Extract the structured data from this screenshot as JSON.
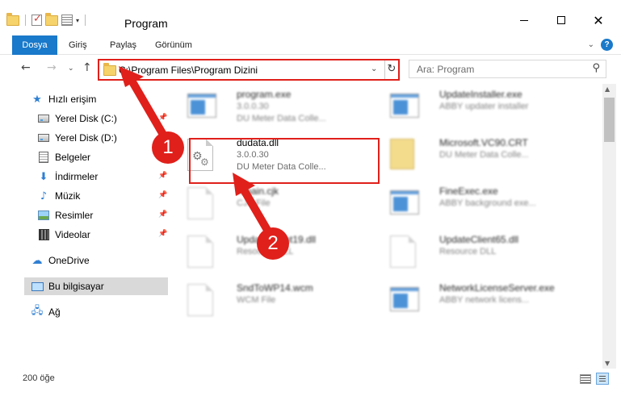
{
  "window": {
    "title": "Program",
    "minimize": "—",
    "maximize": "",
    "close": "✕"
  },
  "ribbon": {
    "tabs": [
      "Dosya",
      "Giriş",
      "Paylaş",
      "Görünüm"
    ],
    "expand_symbol": "⌄",
    "help_symbol": "?"
  },
  "navigation": {
    "back_symbol": "←",
    "forward_symbol": "→",
    "recent_symbol": "⌄",
    "up_symbol": "↑",
    "address": "C:\\Program Files\\Program Dizini",
    "address_dropdown_symbol": "⌄",
    "refresh_symbol": "↻",
    "search_placeholder": "Ara: Program",
    "search_symbol": "⚲"
  },
  "sidebar": {
    "items": [
      {
        "label": "Hızlı erişim",
        "icon": "star-icon",
        "pinned": false
      },
      {
        "label": "Yerel Disk (C:)",
        "icon": "drive-icon",
        "pinned": true
      },
      {
        "label": "Yerel Disk (D:)",
        "icon": "drive-icon",
        "pinned": true
      },
      {
        "label": "Belgeler",
        "icon": "documents-icon",
        "pinned": true
      },
      {
        "label": "İndirmeler",
        "icon": "download-icon",
        "pinned": true
      },
      {
        "label": "Müzik",
        "icon": "music-icon",
        "pinned": true
      },
      {
        "label": "Resimler",
        "icon": "pictures-icon",
        "pinned": true
      },
      {
        "label": "Videolar",
        "icon": "videos-icon",
        "pinned": true
      },
      {
        "label": "OneDrive",
        "icon": "cloud-icon",
        "pinned": false
      },
      {
        "label": "Bu bilgisayar",
        "icon": "computer-icon",
        "pinned": false
      },
      {
        "label": "Ağ",
        "icon": "network-icon",
        "pinned": false
      }
    ],
    "pin_symbol": "📌"
  },
  "files": [
    {
      "name": "program.exe",
      "line2": "3.0.0.30",
      "line3": "DU Meter Data Colle...",
      "icon": "exe-icon",
      "blurred": true
    },
    {
      "name": "UpdateInstaller.exe",
      "line2": "ABBY updater installer",
      "line3": "",
      "icon": "exe-icon",
      "blurred": true
    },
    {
      "name": "dudata.dll",
      "line2": "3.0.0.30",
      "line3": "DU Meter Data Colle...",
      "icon": "dll-icon",
      "blurred": false
    },
    {
      "name": "Microsoft.VC90.CRT",
      "line2": "DU Meter Data Colle...",
      "line3": "",
      "icon": "folder-icon",
      "blurred": true
    },
    {
      "name": "Kmain.cjk",
      "line2": "CJK File",
      "line3": "",
      "icon": "file-icon",
      "blurred": true
    },
    {
      "name": "FineExec.exe",
      "line2": "ABBY background exe...",
      "line3": "",
      "icon": "exe-icon",
      "blurred": true
    },
    {
      "name": "UpdateClient19.dll",
      "line2": "Resource DLL",
      "line3": "",
      "icon": "dll-icon",
      "blurred": true
    },
    {
      "name": "UpdateClient65.dll",
      "line2": "Resource DLL",
      "line3": "",
      "icon": "dll-icon",
      "blurred": true
    },
    {
      "name": "SndToWP14.wcm",
      "line2": "WCM File",
      "line3": "",
      "icon": "file-icon",
      "blurred": true
    },
    {
      "name": "NetworkLicenseServer.exe",
      "line2": "ABBY network licens...",
      "line3": "",
      "icon": "exe-icon",
      "blurred": true
    }
  ],
  "status": {
    "item_count": "200 öğe"
  },
  "annotations": {
    "callout_1": "1",
    "callout_2": "2",
    "color": "#e0201b"
  },
  "colors": {
    "accent": "#1979ca",
    "selection": "#d9d9d9"
  }
}
